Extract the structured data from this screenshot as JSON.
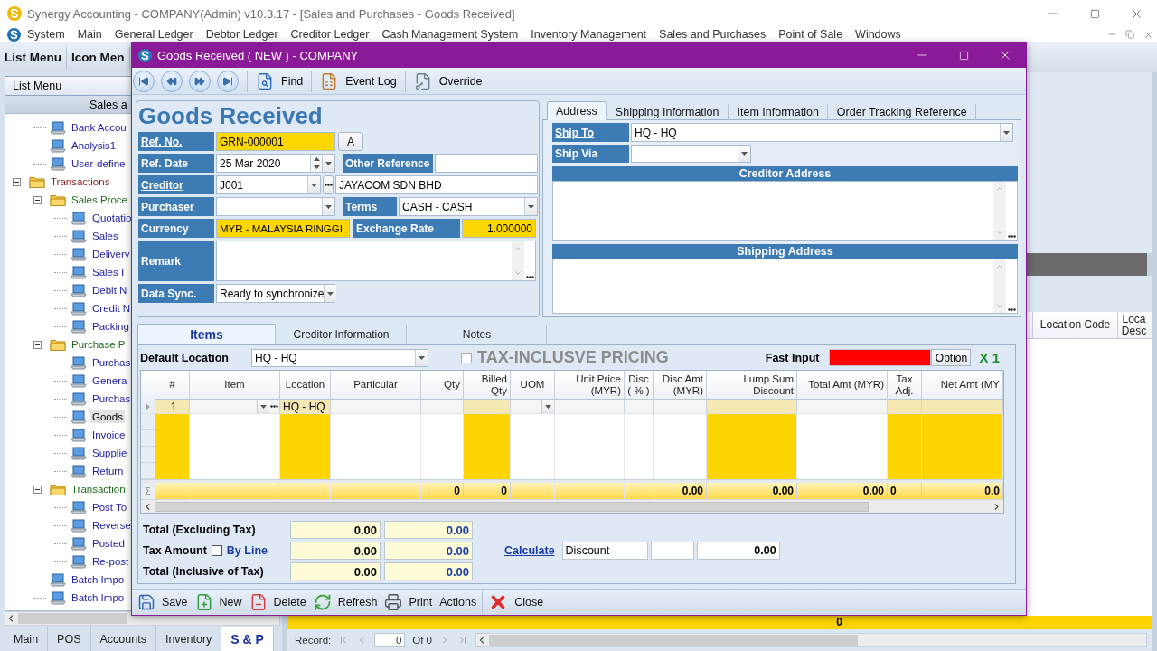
{
  "app": {
    "title": "Synergy Accounting - COMPANY(Admin) v10.3.17 - [Sales and Purchases - Goods Received]",
    "menu": [
      "System",
      "Main",
      "General Ledger",
      "Debtor Ledger",
      "Creditor Ledger",
      "Cash Management System",
      "Inventory Management",
      "Sales and Purchases",
      "Point of Sale",
      "Windows"
    ]
  },
  "side_panel": {
    "tabs": [
      "List Menu",
      "Icon Men"
    ],
    "header": "List Menu",
    "group": "Sales a",
    "tree": [
      {
        "children": [
          {
            "kind": "form",
            "label": "Bank Accou",
            "selected": false
          },
          {
            "kind": "form",
            "label": "Analysis1",
            "selected": false
          },
          {
            "kind": "form",
            "label": "User-define",
            "selected": false
          }
        ]
      },
      {
        "kind": "folder",
        "label": "Transactions",
        "expanded": true,
        "children": [
          {
            "kind": "folder",
            "label": "Sales Proce",
            "expanded": true,
            "children": [
              {
                "kind": "form",
                "label": "Quotatio",
                "selected": false
              },
              {
                "kind": "form",
                "label": "Sales",
                "selected": false
              },
              {
                "kind": "form",
                "label": "Delivery",
                "selected": false
              },
              {
                "kind": "form",
                "label": "Sales I",
                "selected": false
              },
              {
                "kind": "form",
                "label": "Debit N",
                "selected": false
              },
              {
                "kind": "form",
                "label": "Credit N",
                "selected": false
              },
              {
                "kind": "form",
                "label": "Packing",
                "selected": false
              }
            ]
          },
          {
            "kind": "folder",
            "label": "Purchase P",
            "expanded": true,
            "children": [
              {
                "kind": "form",
                "label": "Purchas",
                "selected": false
              },
              {
                "kind": "form",
                "label": "Genera",
                "selected": false
              },
              {
                "kind": "form",
                "label": "Purchas",
                "selected": false
              },
              {
                "kind": "form",
                "label": "Goods",
                "selected": true
              },
              {
                "kind": "form",
                "label": "Invoice",
                "selected": false
              },
              {
                "kind": "form",
                "label": "Supplie",
                "selected": false
              },
              {
                "kind": "form",
                "label": "Return",
                "selected": false
              }
            ]
          },
          {
            "kind": "folder",
            "label": "Transaction",
            "expanded": true,
            "children": [
              {
                "kind": "form",
                "label": "Post To",
                "selected": false
              },
              {
                "kind": "form",
                "label": "Reverse",
                "selected": false
              },
              {
                "kind": "form",
                "label": "Posted",
                "selected": false
              },
              {
                "kind": "form",
                "label": "Re-post",
                "selected": false
              }
            ]
          },
          {
            "kind": "form",
            "label": "Batch Impo",
            "selected": false
          },
          {
            "kind": "form",
            "label": "Batch Impo",
            "selected": false
          }
        ]
      }
    ],
    "bottom_tabs": [
      {
        "label": "Main",
        "selected": false
      },
      {
        "label": "POS",
        "selected": false
      },
      {
        "label": "Accounts",
        "selected": false
      },
      {
        "label": "Inventory",
        "selected": false
      },
      {
        "label": "S & P",
        "selected": true
      }
    ]
  },
  "dialog": {
    "title": "Goods Received ( NEW ) - COMPANY",
    "toolbar": [
      {
        "kind": "first"
      },
      {
        "kind": "previous"
      },
      {
        "kind": "next"
      },
      {
        "kind": "last"
      },
      {
        "kind": "find",
        "label": "Find"
      },
      {
        "kind": "event_log",
        "label": "Event Log"
      },
      {
        "kind": "override",
        "label": "Override"
      }
    ],
    "form": {
      "heading": "Goods Received",
      "ref_no": {
        "label": "Ref. No.",
        "link": true,
        "value": "GRN-000001",
        "highlight": true,
        "button": "A"
      },
      "ref_date": {
        "label": "Ref. Date",
        "value": "25 Mar 2020"
      },
      "other_reference": {
        "label": "Other Reference"
      },
      "creditor": {
        "label": "Creditor",
        "link": true,
        "value": "J001",
        "name": "JAYACOM SDN BHD"
      },
      "purchaser": {
        "label": "Purchaser",
        "link": true
      },
      "terms": {
        "label": "Terms",
        "link": true,
        "value": "CASH - CASH"
      },
      "currency": {
        "label": "Currency",
        "value": "MYR - MALAYSIA RINGGI",
        "highlight": true
      },
      "exchange_rate": {
        "label": "Exchange Rate",
        "value": "1.000000",
        "highlight": true
      },
      "remark": {
        "label": "Remark"
      },
      "data_sync": {
        "label": "Data Sync.",
        "value": "Ready to synchronize"
      }
    },
    "address_tabs": [
      {
        "label": "Address",
        "selected": true
      },
      {
        "label": "Shipping Information",
        "selected": false
      },
      {
        "label": "Item Information",
        "selected": false
      },
      {
        "label": "Order Tracking Reference",
        "selected": false
      }
    ],
    "address": {
      "ship_to": {
        "label": "Ship To",
        "link": true,
        "value": "HQ - HQ"
      },
      "ship_via": {
        "label": "Ship Via"
      },
      "creditor_address": "Creditor Address",
      "shipping_address": "Shipping Address"
    },
    "item_tabs": [
      {
        "label": "Items",
        "selected": true
      },
      {
        "label": "Creditor Information",
        "selected": false
      },
      {
        "label": "Notes",
        "selected": false
      }
    ],
    "items": {
      "default_location": {
        "label": "Default Location",
        "value": "HQ - HQ"
      },
      "tax_inclusive": {
        "label": "TAX-INCLUSVE PRICING",
        "checked": false,
        "disabled": true
      },
      "fast_input": {
        "label": "Fast Input",
        "button": "Option",
        "multiplier": "X 1"
      },
      "grid": {
        "columns": [
          {
            "label": "#",
            "kind": "index",
            "highlight": true
          },
          {
            "label": "Item",
            "kind": "lookup",
            "highlight": false
          },
          {
            "label": "Location",
            "kind": "text",
            "highlight": true
          },
          {
            "label": "Particular",
            "kind": "text",
            "highlight": false
          },
          {
            "label": "Qty",
            "kind": "number",
            "highlight": false
          },
          {
            "label": "Billed Qty",
            "kind": "number",
            "highlight": true
          },
          {
            "label": "UOM",
            "kind": "dropdown",
            "highlight": false
          },
          {
            "label": "Unit Price (MYR)",
            "kind": "number",
            "highlight": false
          },
          {
            "label": "Disc ( % )",
            "kind": "percent",
            "highlight": false
          },
          {
            "label": "Disc Amt (MYR)",
            "kind": "number",
            "highlight": false
          },
          {
            "label": "Lump Sum Discount",
            "kind": "number",
            "highlight": true
          },
          {
            "label": "Total Amt (MYR)",
            "kind": "number",
            "highlight": false
          },
          {
            "label": "Tax Adj.",
            "kind": "flag",
            "highlight": true
          },
          {
            "label": "Net Amt (MY",
            "kind": "number",
            "highlight": true
          }
        ],
        "rows": [
          {
            "selected": true,
            "cells": [
              "1",
              null,
              "HQ - HQ",
              null,
              null,
              null,
              null,
              null,
              null,
              null,
              null,
              null,
              null,
              null
            ]
          }
        ],
        "summary": {
          "mark": "Σ",
          "cells": [
            null,
            null,
            null,
            null,
            "0",
            "0",
            null,
            null,
            null,
            "0.00",
            "0.00",
            "0.00",
            "0",
            "0.0"
          ]
        }
      }
    },
    "totals": {
      "rows": [
        {
          "label": "Total (Excluding Tax)",
          "amount": "0.00",
          "local_amount": "0.00"
        },
        {
          "label": "Tax Amount",
          "by_line": {
            "label": "By Line",
            "checked": false
          },
          "amount": "0.00",
          "local_amount": "0.00"
        },
        {
          "label": "Total (Inclusive of Tax)",
          "amount": "0.00",
          "local_amount": "0.00"
        }
      ],
      "calculate": "Calculate",
      "discount": {
        "description": "Discount",
        "amount": "0.00"
      }
    },
    "actions": [
      {
        "kind": "save",
        "label": "Save"
      },
      {
        "kind": "new",
        "label": "New"
      },
      {
        "kind": "delete",
        "label": "Delete"
      },
      {
        "kind": "refresh",
        "label": "Refresh"
      },
      {
        "kind": "print",
        "label": "Print"
      },
      {
        "kind": "menu",
        "label": "Actions"
      },
      {
        "kind": "close",
        "label": "Close"
      }
    ]
  },
  "background": {
    "columns": [
      "Location Code",
      "Loca Desc"
    ],
    "total": "0",
    "status": {
      "label": "Record:",
      "value": "0",
      "count": "Of 0"
    }
  }
}
